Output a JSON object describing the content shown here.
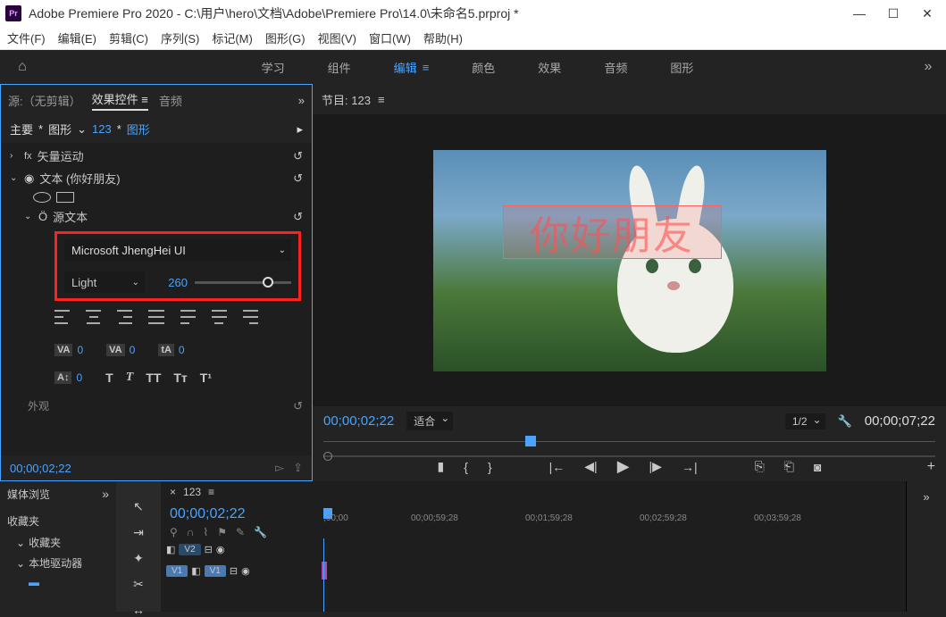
{
  "titlebar": {
    "app_icon_text": "Pr",
    "title": "Adobe Premiere Pro 2020 - C:\\用户\\hero\\文档\\Adobe\\Premiere Pro\\14.0\\未命名5.prproj *"
  },
  "menubar": [
    "文件(F)",
    "编辑(E)",
    "剪辑(C)",
    "序列(S)",
    "标记(M)",
    "图形(G)",
    "视图(V)",
    "窗口(W)",
    "帮助(H)"
  ],
  "workspaces": {
    "items": [
      "学习",
      "组件",
      "编辑",
      "颜色",
      "效果",
      "音频",
      "图形"
    ],
    "active_index": 2,
    "more": "»"
  },
  "source_panel": {
    "tabs": {
      "source": "源:（无剪辑）",
      "effect_controls": "效果控件",
      "audio": "音频",
      "more": "»"
    },
    "breadcrumb": {
      "main": "主要",
      "graphic": "图形",
      "chev": "⌄",
      "seq": "123",
      "graphic2": "图形",
      "arrow": "▸"
    },
    "rows": {
      "vector_motion": "矢量运动",
      "text_layer": "文本 (你好朋友)",
      "source_text": "源文本",
      "outline_label": "外观"
    },
    "font": {
      "family": "Microsoft JhengHei UI",
      "weight": "Light",
      "size": "260"
    },
    "spacing": {
      "va_icon": "VA",
      "va1": "0",
      "va2": "0",
      "ta_icon": "tA",
      "ta": "0",
      "leading_icon": "A↕",
      "leading": "0"
    },
    "text_styles": {
      "bold": "T",
      "italic": "T",
      "allcaps": "TT",
      "smallcaps": "Tᴛ",
      "super": "T¹"
    },
    "footer_timecode": "00;00;02;22"
  },
  "program_panel": {
    "title_prefix": "节目:",
    "seq_name": "123",
    "overlay_text": "你好朋友",
    "timecode_current": "00;00;02;22",
    "fit_label": "适合",
    "res_label": "1/2",
    "duration": "00;00;07;22"
  },
  "media_browser": {
    "tab": "媒体浏览",
    "more": "»",
    "favorites_header": "收藏夹",
    "favorites": "收藏夹",
    "local_drives": "本地驱动器"
  },
  "timeline": {
    "seq_tab_prefix": "×",
    "seq_name": "123",
    "timecode": "00;00;02;22",
    "ruler_marks": [
      ";00;00",
      "00;00;59;28",
      "00;01;59;28",
      "00;02;59;28",
      "00;03;59;28"
    ],
    "tracks": {
      "v2": "V2",
      "v1": "V1",
      "v1_src": "V1"
    }
  }
}
